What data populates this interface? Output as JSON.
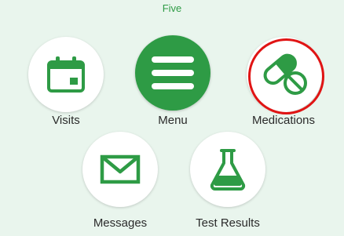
{
  "header": {
    "partial_label": "Five"
  },
  "grid": {
    "visits_label": "Visits",
    "menu_label": "Menu",
    "medications_label": "Medications",
    "messages_label": "Messages",
    "test_results_label": "Test Results"
  },
  "colors": {
    "accent": "#2e9b45",
    "background": "#e9f5ed",
    "highlight": "#e01414",
    "tile": "#ffffff"
  }
}
